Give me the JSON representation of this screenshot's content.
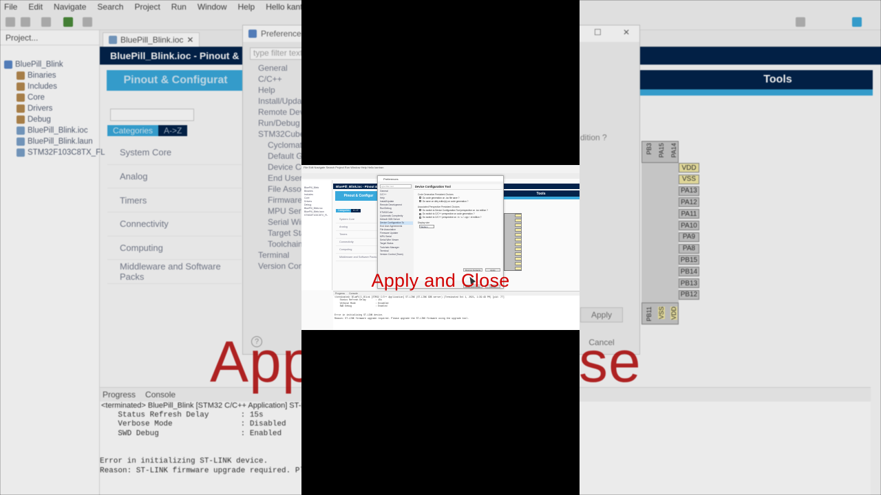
{
  "menubar": [
    "File",
    "Edit",
    "Navigate",
    "Search",
    "Project",
    "Run",
    "Window",
    "Help",
    "Hello kantran"
  ],
  "project_panel": {
    "tab_label": "Project...",
    "tree": [
      {
        "label": "BluePill_Blink",
        "kind": "proj"
      },
      {
        "label": "Binaries",
        "kind": "folder"
      },
      {
        "label": "Includes",
        "kind": "folder"
      },
      {
        "label": "Core",
        "kind": "folder"
      },
      {
        "label": "Drivers",
        "kind": "folder"
      },
      {
        "label": "Debug",
        "kind": "folder"
      },
      {
        "label": "BluePill_Blink.ioc",
        "kind": "file"
      },
      {
        "label": "BluePill_Blink.laun",
        "kind": "file"
      },
      {
        "label": "STM32F103C8TX_FL",
        "kind": "file"
      }
    ]
  },
  "editor": {
    "tab_label": "BluePill_Blink.ioc",
    "header": "BluePill_Blink.ioc - Pinout & C",
    "pinout_tab": "Pinout & Configurat",
    "tools_tab": "Tools",
    "categories_tab": "Categories",
    "az_tab": "A->Z",
    "categories": [
      "System Core",
      "Analog",
      "Timers",
      "Connectivity",
      "Computing",
      "Middleware and Software Packs"
    ]
  },
  "preferences": {
    "title": "Preferences",
    "filter_placeholder": "type filter text",
    "tree": [
      {
        "label": "General",
        "level": "top"
      },
      {
        "label": "C/C++",
        "level": "top"
      },
      {
        "label": "Help",
        "level": "top"
      },
      {
        "label": "Install/Update",
        "level": "top"
      },
      {
        "label": "Remote Devel",
        "level": "top"
      },
      {
        "label": "Run/Debug",
        "level": "top"
      },
      {
        "label": "STM32Cube",
        "level": "top"
      },
      {
        "label": "Cyclomati",
        "level": "sub"
      },
      {
        "label": "Default GD",
        "level": "sub"
      },
      {
        "label": "Device Co",
        "level": "sub"
      },
      {
        "label": "End User A",
        "level": "sub"
      },
      {
        "label": "File Assoc",
        "level": "sub"
      },
      {
        "label": "Firmware",
        "level": "sub"
      },
      {
        "label": "MPU Serial",
        "level": "sub"
      },
      {
        "label": "Serial Wire",
        "level": "sub"
      },
      {
        "label": "Target Stat",
        "level": "sub"
      },
      {
        "label": "Toolchain",
        "level": "sub"
      },
      {
        "label": "Terminal",
        "level": "top"
      },
      {
        "label": "Version Contr",
        "level": "top"
      }
    ],
    "apply_label": "Apply",
    "cancel_label": "Cancel",
    "partial_question": "dition ?"
  },
  "pins": [
    "VDD",
    "VSS",
    "PA13",
    "PA12",
    "PA11",
    "PA10",
    "PA9",
    "PA8",
    "PB15",
    "PB14",
    "PB13",
    "PB12"
  ],
  "top_pins": [
    "PB3",
    "PA15",
    "PA14"
  ],
  "bottom_pins": [
    "PB11",
    "VSS",
    "VDD"
  ],
  "console": {
    "progress_tab": "Progress",
    "console_tab": "Console",
    "header": "<terminated> BluePill_Blink [STM32 C/C++ Application] ST-LI",
    "lines": [
      "    Status Refresh Delay       : 15s",
      "    Verbose Mode               : Disabled",
      "    SWD Debug                  : Enabled",
      "",
      "",
      "Error in initializing ST-LINK device.",
      "Reason: ST-LINK firmware upgrade required. Plea"
    ]
  },
  "overlay_big": "Apply and Close",
  "frame": {
    "menu": "File  Edit  Navigate  Search  Project  Run  Window  Help  Hello kantran",
    "header": "BluePill_Blink.ioc - Pinout & C",
    "pinout_tab": "Pinout & Configur",
    "tools_tab": "Tools",
    "categories_tab": "Categories",
    "az_tab": "A->Z",
    "categories": [
      "System Core",
      "Analog",
      "Timers",
      "Connectivity",
      "Computing",
      "Middleware and Software Packs"
    ],
    "left_tree": [
      "BluePill_Blink",
      "Binaries",
      "Includes",
      "Core",
      "Drivers",
      "Debug",
      "BluePill_Blink.ioc",
      "BluePill_Blink.laun",
      "STM32F103C8TX_FL"
    ],
    "dialog_title": "Preferences",
    "dialog_filter": "type filter text",
    "dialog_tree": [
      {
        "label": "General",
        "sel": false
      },
      {
        "label": "C/C++",
        "sel": false
      },
      {
        "label": "Help",
        "sel": false
      },
      {
        "label": "Install/Update",
        "sel": false
      },
      {
        "label": "Remote Development",
        "sel": false
      },
      {
        "label": "Run/Debug",
        "sel": false
      },
      {
        "label": "STM32Cube",
        "sel": false
      },
      {
        "label": "  Cyclomatic Complexity",
        "sel": false
      },
      {
        "label": "  Default GDB Server",
        "sel": false
      },
      {
        "label": "  Device Configuration To",
        "sel": true
      },
      {
        "label": "  End User Agreements",
        "sel": false
      },
      {
        "label": "  File Association",
        "sel": false
      },
      {
        "label": "  Firmware Updater",
        "sel": false
      },
      {
        "label": "  MPU Serial",
        "sel": false
      },
      {
        "label": "  Serial Wire Viewer",
        "sel": false
      },
      {
        "label": "  Target Status",
        "sel": false
      },
      {
        "label": "  Toolchain Manager",
        "sel": false
      },
      {
        "label": "Terminal",
        "sel": false
      },
      {
        "label": "Version Control (Team)",
        "sel": false
      }
    ],
    "page_title": "Device Configuration Tool",
    "group1": "Code Generation Persistent Choices",
    "options1": [
      "Do code generation on .ioc file save ?",
      "Do save on dirty editor(s) on code generation ?"
    ],
    "group2": "Associated Perspective Persistent Choices",
    "options2": [
      "Do switch to Device Configuration Tool perspective on .ioc edition ?",
      "Do switch to C/C++ perspective on code generation ?",
      "Do switch to C/C++ perspective on .h / .c / .cpp / .ld edition ?"
    ],
    "display_label": "Display size",
    "display_value": "Medium",
    "restore_label": "Restore Defaults",
    "apply_label": "Apply",
    "apply_close_label": "Apply and Close",
    "cancel_label": "Cancel",
    "progress_tab": "Progress",
    "console_tab": "Console",
    "console_header": "<terminated> BluePill_Blink [STM32 C/C++ Application] ST-LINK (ST-LINK GDB server) (Terminated Oct 1, 2021, 1:39:49 PM) [pid: 77]",
    "console_lines": [
      "    Status Refresh Delay       : 15s",
      "    Verbose Mode               : Disabled",
      "    SWD Debug                  : Enabled",
      "",
      "",
      "Error in initializing ST-LINK device.",
      "Reason: ST-LINK firmware upgrade required. Please upgrade the ST-LINK firmware using the upgrade tool."
    ],
    "caption": "Apply and Close"
  }
}
